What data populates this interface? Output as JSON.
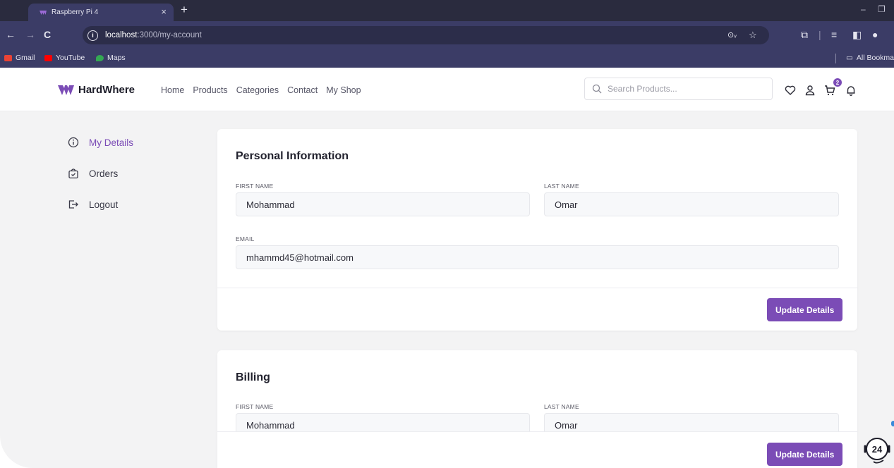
{
  "browser": {
    "tab_title": "Raspberry Pi 4",
    "tab_close": "×",
    "new_tab": "+",
    "url_host": "localhost",
    "url_path": ":3000/my-account",
    "bookmarks": [
      {
        "label": "Gmail",
        "color": "#ea4335"
      },
      {
        "label": "YouTube",
        "color": "#ff0000"
      },
      {
        "label": "Maps",
        "color": "#34a853"
      }
    ],
    "all_bookmarks": "All Bookma"
  },
  "site": {
    "brand": "HardWhere",
    "brand_color": "#7b4cb6",
    "nav": [
      "Home",
      "Products",
      "Categories",
      "Contact",
      "My Shop"
    ],
    "search_placeholder": "Search Products...",
    "cart_count": "2"
  },
  "sidebar": {
    "items": [
      {
        "label": "My Details",
        "icon": "info-circle-icon",
        "active": true
      },
      {
        "label": "Orders",
        "icon": "shopping-bag-check-icon",
        "active": false
      },
      {
        "label": "Logout",
        "icon": "logout-icon",
        "active": false
      }
    ]
  },
  "personal": {
    "title": "Personal Information",
    "first_name_label": "FIRST NAME",
    "first_name": "Mohammad",
    "last_name_label": "LAST NAME",
    "last_name": "Omar",
    "email_label": "EMAIL",
    "email": "mhammd45@hotmail.com",
    "button": "Update Details"
  },
  "billing": {
    "title": "Billing",
    "first_name_label": "FIRST NAME",
    "first_name": "Mohammad",
    "last_name_label": "LAST NAME",
    "last_name": "Omar",
    "button": "Update Details"
  },
  "support": {
    "label": "24"
  }
}
